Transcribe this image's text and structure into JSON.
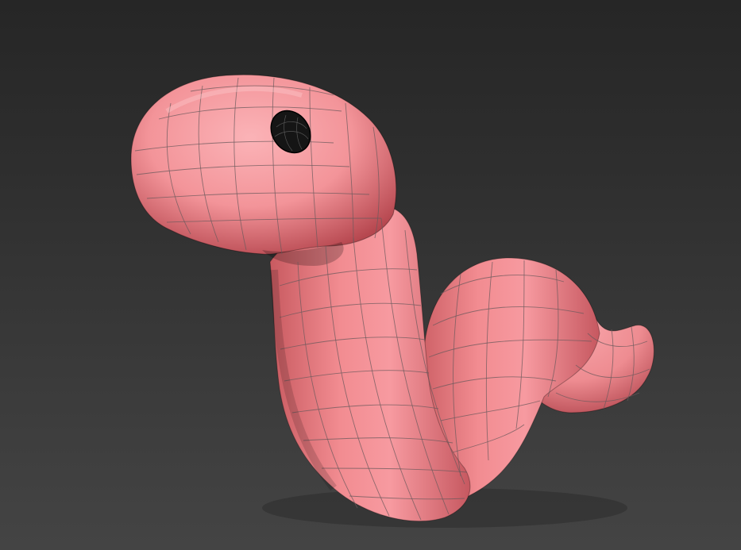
{
  "viewport": {
    "background_top": "#262626",
    "background_bottom": "#444444"
  },
  "model": {
    "name_icon": "worm-model",
    "body_color": "#f08f93",
    "highlight_color": "#fbb4b8",
    "shadow_color": "#b85056",
    "wire_color": "#6b5a5c",
    "eye_color": "#151515"
  }
}
